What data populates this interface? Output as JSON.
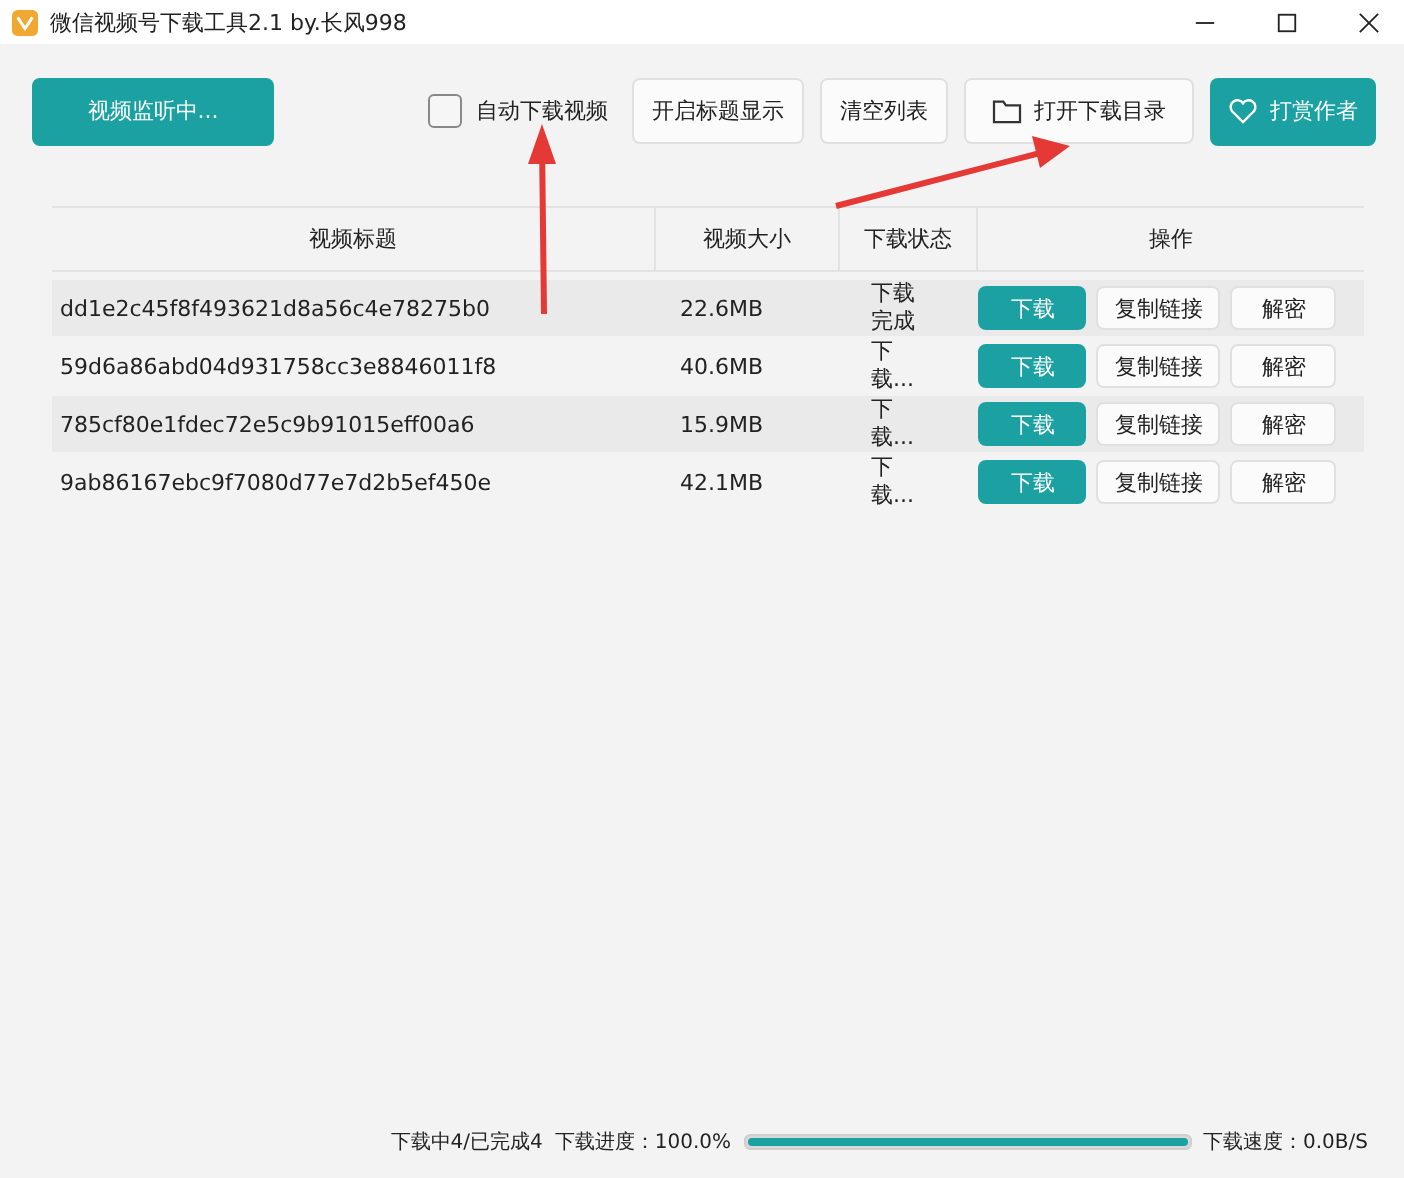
{
  "window": {
    "title": "微信视频号下载工具2.1 by.长风998"
  },
  "toolbar": {
    "monitor_button": "视频监听中...",
    "auto_download": {
      "label": "自动下载视频",
      "checked": false
    },
    "title_button": "开启标题显示",
    "clear_button": "清空列表",
    "open_folder_button": "打开下载目录",
    "donate_button": "打赏作者"
  },
  "table": {
    "columns": [
      "视频标题",
      "视频大小",
      "下载状态",
      "操作"
    ],
    "rows": [
      {
        "title": "dd1e2c45f8f493621d8a56c4e78275b0",
        "size": "22.6MB",
        "status": "下载完成",
        "actions": [
          "下载",
          "复制链接",
          "解密"
        ]
      },
      {
        "title": "59d6a86abd04d931758cc3e8846011f8",
        "size": "40.6MB",
        "status": "下载...",
        "actions": [
          "下载",
          "复制链接",
          "解密"
        ]
      },
      {
        "title": "785cf80e1fdec72e5c9b91015eff00a6",
        "size": "15.9MB",
        "status": "下载...",
        "actions": [
          "下载",
          "复制链接",
          "解密"
        ]
      },
      {
        "title": "9ab86167ebc9f7080d77e7d2b5ef450e",
        "size": "42.1MB",
        "status": "下载...",
        "actions": [
          "下载",
          "复制链接",
          "解密"
        ]
      }
    ]
  },
  "status_bar": {
    "counts": "下载中4/已完成4",
    "progress_label": "下载进度：100.0%",
    "progress": {
      "level": 1
    },
    "speed": "下载速度：0.0B/S"
  }
}
